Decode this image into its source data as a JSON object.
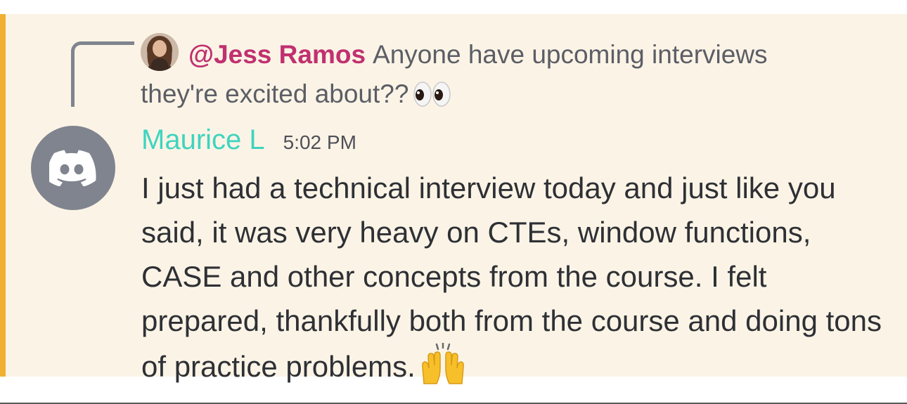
{
  "reply": {
    "mention": "@Jess Ramos",
    "text": "Anyone have upcoming interviews they're excited about??",
    "emoji": "eyes-emoji"
  },
  "message": {
    "author": "Maurice L",
    "timestamp": "5:02 PM",
    "body": "I just had a technical interview today and just like you said, it was very heavy on CTEs, window functions, CASE and other concepts from the course. I felt prepared, thankfully both from the course and doing tons of practice problems.",
    "emoji": "raising-hands-emoji"
  },
  "colors": {
    "highlight_bg": "#fbf4e6",
    "highlight_border": "#f0b132",
    "mention": "#c1306f",
    "author": "#3fd4bf",
    "avatar_bg": "#80848e"
  }
}
